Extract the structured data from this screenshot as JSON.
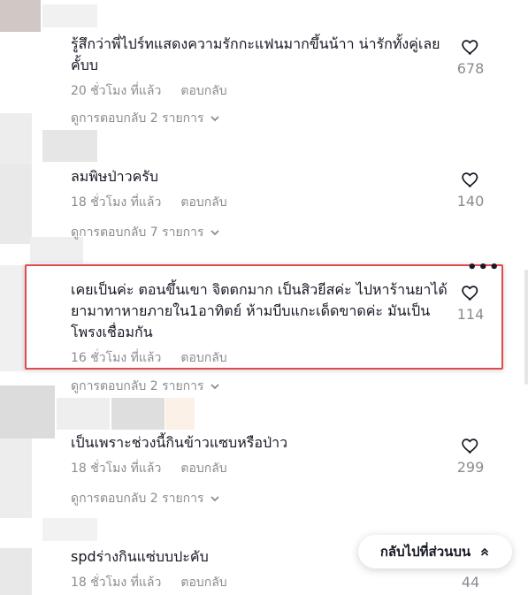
{
  "comments": [
    {
      "text": "รู้สึกว่าพี่ไปร์ทแสดงความรักกะแฟนมากขึ้นน้าา น่ารักทั้งคู่เลยคั้บบ",
      "time": "20 ชั่วโมง ที่แล้ว",
      "reply_label": "ตอบกลับ",
      "likes": "678",
      "view_replies": "ดูการตอบกลับ 2 รายการ"
    },
    {
      "text": "ลมพิษป่าวครับ",
      "time": "18 ชั่วโมง ที่แล้ว",
      "reply_label": "ตอบกลับ",
      "likes": "140",
      "view_replies": "ดูการตอบกลับ 7 รายการ"
    },
    {
      "text": "เคยเป็นค่ะ ตอนขึ้นเขา จิตตกมาก เป็นสิวยีสค่ะ ไปหาร้านยาได้ยามาทาหายภายใน1อาทิตย์ ห้ามบีบแกะเด็ดขาดค่ะ มันเป็นโพรงเชื่อมกัน",
      "time": "16 ชั่วโมง ที่แล้ว",
      "reply_label": "ตอบกลับ",
      "likes": "114",
      "view_replies": "ดูการตอบกลับ 2 รายการ"
    },
    {
      "text": "เป็นเพราะช่วงนี้กินข้าวแซบหรือป่าว",
      "time": "18 ชั่วโมง ที่แล้ว",
      "reply_label": "ตอบกลับ",
      "likes": "299",
      "view_replies": "ดูการตอบกลับ 2 รายการ"
    },
    {
      "text": "spdร่างกินแซ่บบปะคับ",
      "time": "18 ชั่วโมง ที่แล้ว",
      "reply_label": "ตอบกลับ",
      "likes": "44"
    }
  ],
  "more_options_label": "•••",
  "back_to_top_label": "กลับไปที่ส่วนบน",
  "colors": {
    "text": "#161823",
    "muted": "#8a8b91",
    "highlight_border": "#e04b4b"
  },
  "icons": [
    "heart-outline-icon",
    "chevron-down-icon",
    "chevron-up-double-icon",
    "more-options-icon"
  ]
}
